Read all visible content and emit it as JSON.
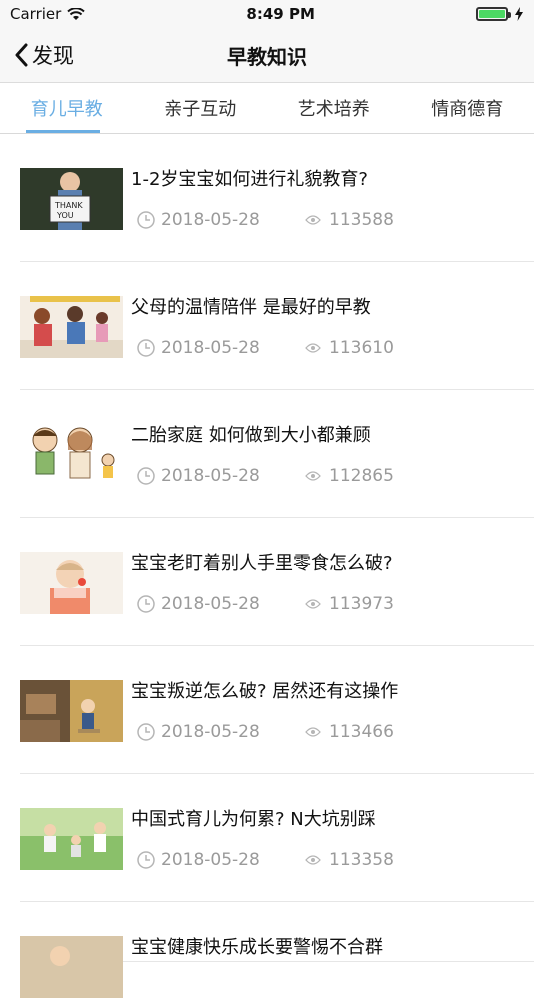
{
  "status": {
    "carrier": "Carrier",
    "time": "8:49 PM"
  },
  "nav": {
    "back_label": "发现",
    "title": "早教知识"
  },
  "tabs": [
    "育儿早教",
    "亲子互动",
    "艺术培养",
    "情商德育"
  ],
  "items": [
    {
      "title": "1-2岁宝宝如何进行礼貌教育?",
      "date": "2018-05-28",
      "views": "113588"
    },
    {
      "title": "父母的温情陪伴 是最好的早教",
      "date": "2018-05-28",
      "views": "113610"
    },
    {
      "title": "二胎家庭 如何做到大小都兼顾",
      "date": "2018-05-28",
      "views": "112865"
    },
    {
      "title": "宝宝老盯着别人手里零食怎么破?",
      "date": "2018-05-28",
      "views": "113973"
    },
    {
      "title": "宝宝叛逆怎么破? 居然还有这操作",
      "date": "2018-05-28",
      "views": "113466"
    },
    {
      "title": "中国式育儿为何累? N大坑别踩",
      "date": "2018-05-28",
      "views": "113358"
    }
  ],
  "partial_item": {
    "title": "宝宝健康快乐成长要警惕不合群"
  },
  "icons": {
    "clock": "clock-icon",
    "eye": "eye-icon",
    "back": "chevron-left-icon",
    "wifi": "wifi-icon",
    "battery": "battery-icon",
    "charge": "bolt-icon"
  },
  "colors": {
    "accent": "#6aaee3",
    "meta": "#9a9a9a"
  }
}
